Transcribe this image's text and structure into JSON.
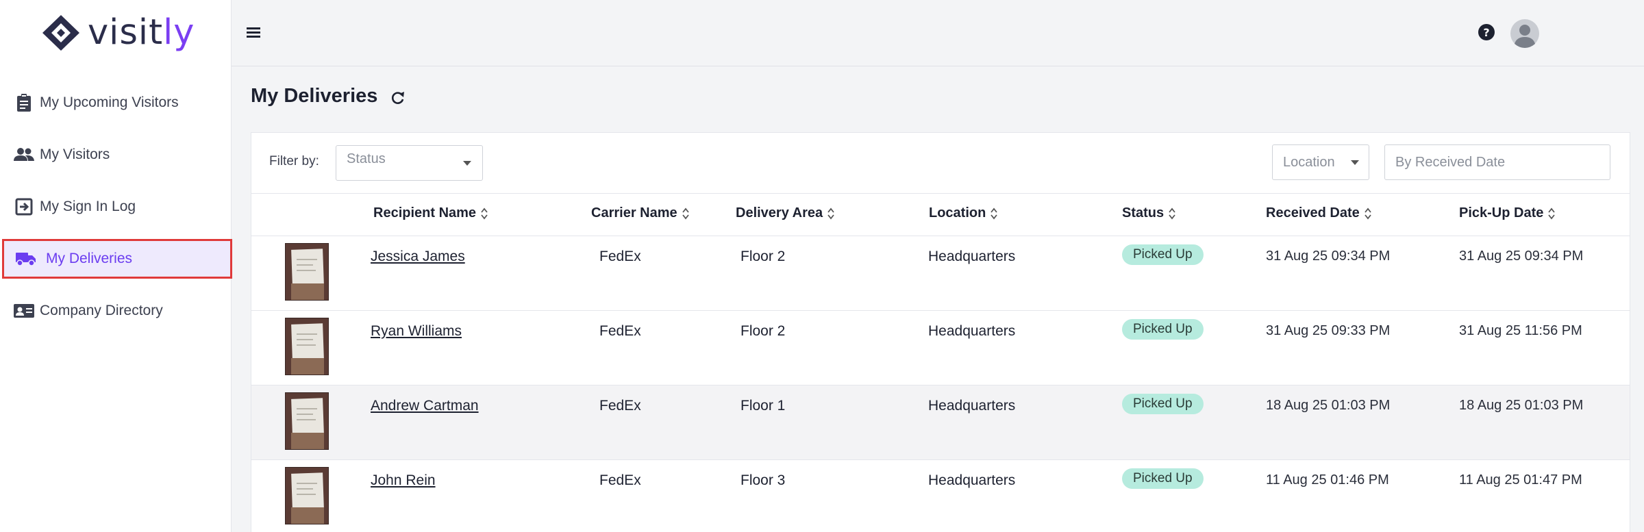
{
  "app": {
    "logo_text_main": "visit",
    "logo_text_accent": "ly",
    "brand_color": "#7b3ff2",
    "accent_highlight": "#e03a3a"
  },
  "sidebar": {
    "items": [
      {
        "label": "My Upcoming Visitors",
        "icon": "clipboard-icon"
      },
      {
        "label": "My Visitors",
        "icon": "people-icon"
      },
      {
        "label": "My Sign In Log",
        "icon": "sign-in-icon"
      },
      {
        "label": "My Deliveries",
        "icon": "delivery-truck-icon",
        "active": true
      },
      {
        "label": "Company Directory",
        "icon": "id-card-icon"
      }
    ]
  },
  "main": {
    "title": "My Deliveries",
    "filters": {
      "label": "Filter by:",
      "status_placeholder": "Status",
      "location_placeholder": "Location",
      "date_placeholder": "By Received Date"
    },
    "columns": [
      "Recipient Name",
      "Carrier Name",
      "Delivery Area",
      "Location",
      "Status",
      "Received Date",
      "Pick-Up Date"
    ],
    "rows": [
      {
        "recipient": "Jessica James",
        "carrier": "FedEx",
        "area": "Floor 2",
        "location": "Headquarters",
        "status": "Picked Up",
        "received": "31 Aug 25 09:34 PM",
        "pickup": "31 Aug 25 09:34 PM"
      },
      {
        "recipient": "Ryan Williams",
        "carrier": "FedEx",
        "area": "Floor 2",
        "location": "Headquarters",
        "status": "Picked Up",
        "received": "31 Aug 25 09:33 PM",
        "pickup": "31 Aug 25 11:56 PM"
      },
      {
        "recipient": "Andrew Cartman",
        "carrier": "FedEx",
        "area": "Floor 1",
        "location": "Headquarters",
        "status": "Picked Up",
        "received": "18 Aug 25 01:03 PM",
        "pickup": "18 Aug 25 01:03 PM"
      },
      {
        "recipient": "John Rein",
        "carrier": "FedEx",
        "area": "Floor 3",
        "location": "Headquarters",
        "status": "Picked Up",
        "received": "11 Aug 25 01:46 PM",
        "pickup": "11 Aug 25 01:47 PM"
      }
    ]
  }
}
